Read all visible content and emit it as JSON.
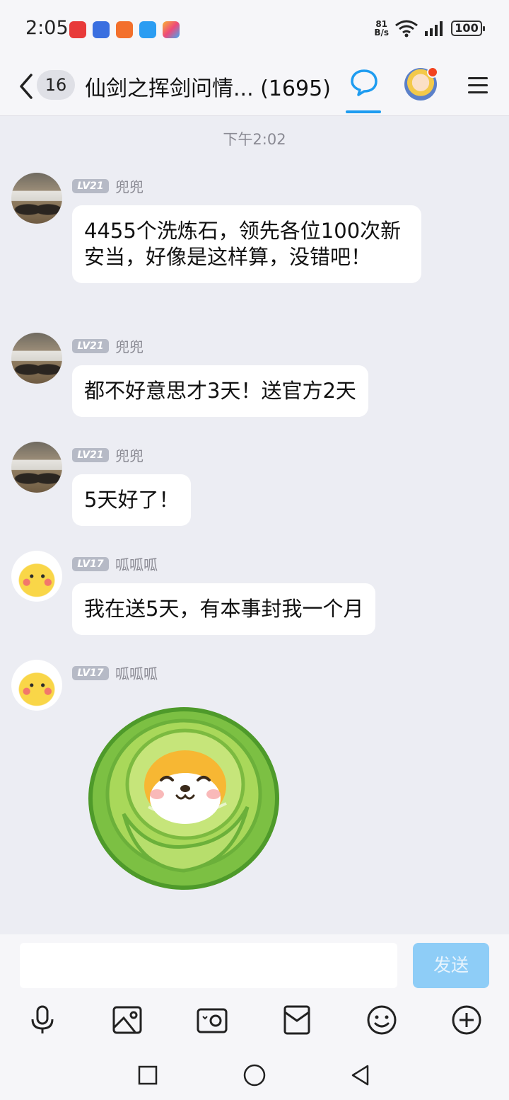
{
  "status_bar": {
    "time": "2:05",
    "net_speed_value": "81",
    "net_speed_unit": "B/s",
    "battery": "100",
    "app_icons": [
      "huawei-appgallery-icon",
      "tieba-icon",
      "taobao-icon",
      "cloud-icon",
      "app-icon"
    ]
  },
  "header": {
    "unread_count": "16",
    "title": "仙剑之挥剑问情... (1695)"
  },
  "timestamp": "下午2:02",
  "messages": [
    {
      "level": "LV21",
      "nick": "兜兜",
      "text": "4455个洗炼石，领先各位100次新安当，好像是这样算，没错吧！",
      "avatar": "jeep-avatar"
    },
    {
      "level": "LV21",
      "nick": "兜兜",
      "text": "都不好意思才3天！送官方2天",
      "avatar": "jeep-avatar"
    },
    {
      "level": "LV21",
      "nick": "兜兜",
      "text": "5天好了！",
      "avatar": "jeep-avatar"
    },
    {
      "level": "LV17",
      "nick": "呱呱呱",
      "text": "我在送5天，有本事封我一个月",
      "avatar": "pikachu-avatar"
    },
    {
      "level": "LV17",
      "nick": "呱呱呱",
      "sticker": "cabbage-shiba-sticker",
      "avatar": "pikachu-avatar"
    }
  ],
  "input": {
    "placeholder": "",
    "value": "",
    "send_label": "发送"
  },
  "toolbar": [
    "microphone-icon",
    "image-icon",
    "camera-icon",
    "red-packet-icon",
    "emoji-icon",
    "plus-icon"
  ],
  "colors": {
    "accent": "#1e9cf0",
    "send_button": "#8ecdf7",
    "background": "#ecedf3",
    "badge": "#b6bac6",
    "notification": "#f2421f"
  }
}
